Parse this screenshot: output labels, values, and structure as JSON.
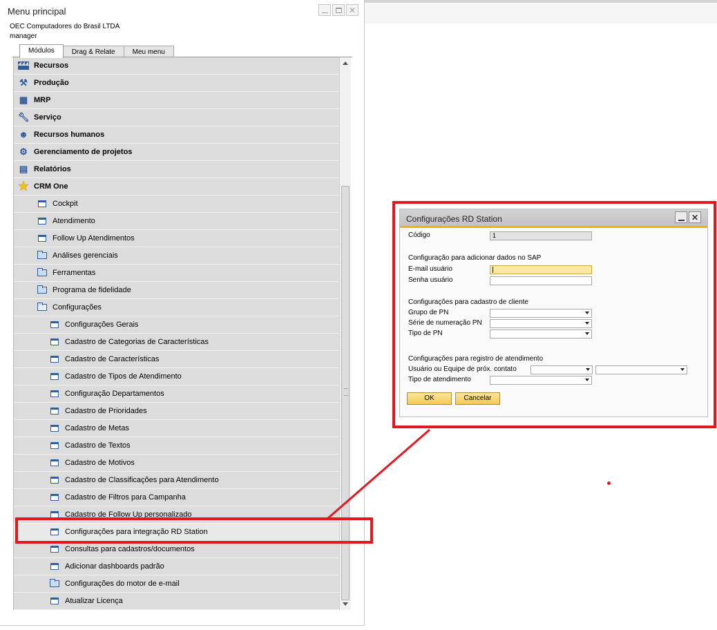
{
  "main_menu": {
    "title": "Menu principal",
    "company": "OEC Computadores do Brasil LTDA",
    "user": "manager",
    "tabs": [
      {
        "label": "Módulos",
        "active": true
      },
      {
        "label": "Drag & Relate",
        "active": false
      },
      {
        "label": "Meu menu",
        "active": false
      }
    ],
    "items": [
      {
        "label": "Recursos",
        "level": 0,
        "icon": "factory-icon"
      },
      {
        "label": "Produção",
        "level": 0,
        "icon": "production-icon"
      },
      {
        "label": "MRP",
        "level": 0,
        "icon": "mrp-icon"
      },
      {
        "label": "Serviço",
        "level": 0,
        "icon": "wrench-icon"
      },
      {
        "label": "Recursos humanos",
        "level": 0,
        "icon": "people-icon"
      },
      {
        "label": "Gerenciamento de projetos",
        "level": 0,
        "icon": "project-icon"
      },
      {
        "label": "Relatórios",
        "level": 0,
        "icon": "report-icon"
      },
      {
        "label": "CRM One",
        "level": 0,
        "icon": "crm-star-icon"
      },
      {
        "label": "Cockpit",
        "level": 1,
        "icon": "window-icon"
      },
      {
        "label": "Atendimento",
        "level": 1,
        "icon": "window-icon"
      },
      {
        "label": "Follow Up Atendimentos",
        "level": 1,
        "icon": "window-icon"
      },
      {
        "label": "Análises gerenciais",
        "level": 1,
        "icon": "folder-icon"
      },
      {
        "label": "Ferramentas",
        "level": 1,
        "icon": "folder-icon"
      },
      {
        "label": "Programa de fidelidade",
        "level": 1,
        "icon": "folder-icon"
      },
      {
        "label": "Configurações",
        "level": 1,
        "icon": "folder-open-icon"
      },
      {
        "label": "Configurações Gerais",
        "level": 2,
        "icon": "window-icon"
      },
      {
        "label": "Cadastro de Categorias de Características",
        "level": 2,
        "icon": "window-icon"
      },
      {
        "label": "Cadastro de Características",
        "level": 2,
        "icon": "window-icon"
      },
      {
        "label": "Cadastro de Tipos de Atendimento",
        "level": 2,
        "icon": "window-icon"
      },
      {
        "label": "Configuração Departamentos",
        "level": 2,
        "icon": "window-icon"
      },
      {
        "label": "Cadastro de Prioridades",
        "level": 2,
        "icon": "window-icon"
      },
      {
        "label": "Cadastro de Metas",
        "level": 2,
        "icon": "window-icon"
      },
      {
        "label": "Cadastro de Textos",
        "level": 2,
        "icon": "window-icon"
      },
      {
        "label": "Cadastro de Motivos",
        "level": 2,
        "icon": "window-icon"
      },
      {
        "label": "Cadastro de Classificações para Atendimento",
        "level": 2,
        "icon": "window-icon"
      },
      {
        "label": "Cadastro de Filtros para Campanha",
        "level": 2,
        "icon": "window-icon"
      },
      {
        "label": "Cadastro de Follow Up personalizado",
        "level": 2,
        "icon": "window-icon"
      },
      {
        "label": "Configurações para integração RD Station",
        "level": 2,
        "icon": "window-icon",
        "selected": true
      },
      {
        "label": "Consultas para cadastros/documentos",
        "level": 2,
        "icon": "window-icon"
      },
      {
        "label": "Adicionar dashboards padrão",
        "level": 2,
        "icon": "window-icon"
      },
      {
        "label": "Configurações do motor de e-mail",
        "level": 2,
        "icon": "folder-icon"
      },
      {
        "label": "Atualizar Licença",
        "level": 2,
        "icon": "window-icon"
      }
    ]
  },
  "dialog": {
    "title": "Configurações RD Station",
    "codigo_label": "Código",
    "codigo_value": "1",
    "section_sap": "Configuração para adicionar dados no SAP",
    "email_label": "E-mail usuário",
    "email_value": "",
    "senha_label": "Senha usuário",
    "senha_value": "",
    "section_cliente": "Configurações para cadastro de cliente",
    "grupo_pn_label": "Grupo de PN",
    "serie_label": "Série de numeração PN",
    "tipo_pn_label": "Tipo de PN",
    "section_atendimento": "Configurações para registro de atendimento",
    "usuario_equipe_label": "Usuário ou Equipe de próx. contato",
    "tipo_atendimento_label": "Tipo de atendimento",
    "ok_label": "OK",
    "cancel_label": "Cancelar"
  },
  "colors": {
    "highlight": "#e3181f",
    "accent_bar": "#f2b200",
    "button_fill": "#f4c94f"
  }
}
